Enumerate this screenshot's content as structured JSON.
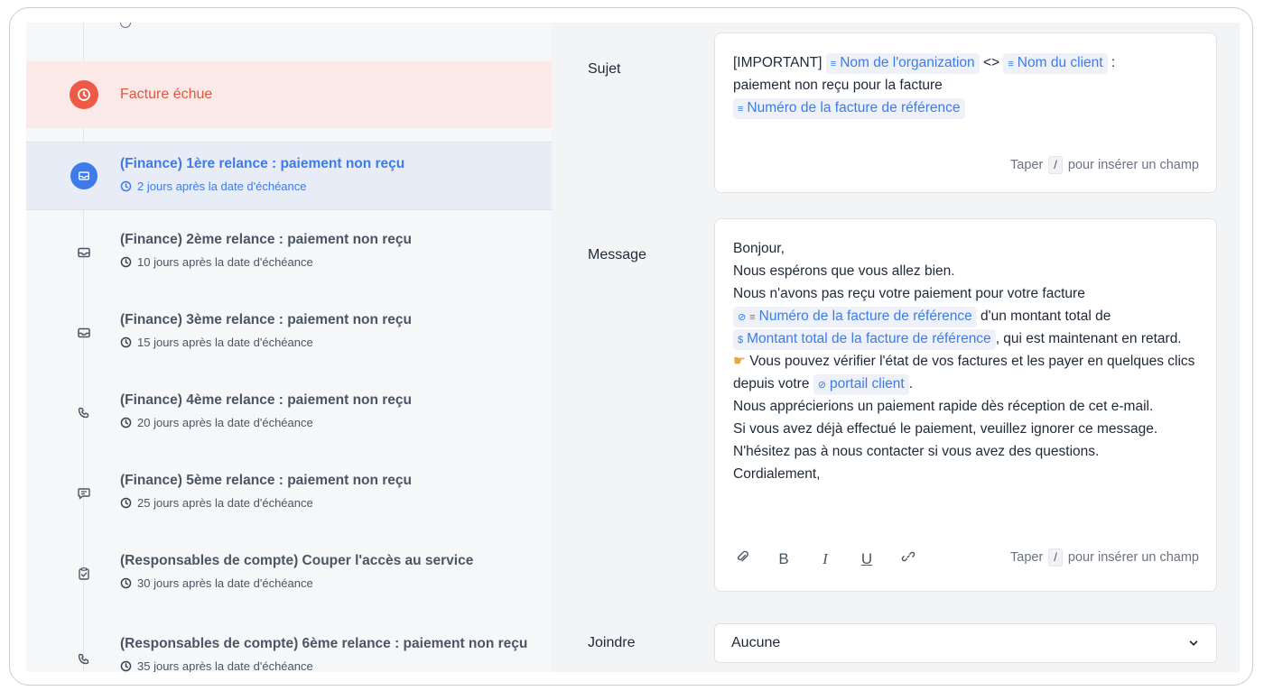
{
  "stub": {
    "text": "·"
  },
  "overdue": {
    "title": "Facture échue",
    "icon": "clock-icon"
  },
  "steps": [
    {
      "title": "(Finance) 1ère relance : paiement non reçu",
      "sub": "2 jours après la date d'échéance",
      "icon": "mail-icon"
    },
    {
      "title": "(Finance) 2ème relance : paiement non reçu",
      "sub": "10 jours après la date d'échéance",
      "icon": "mail-icon"
    },
    {
      "title": "(Finance) 3ème relance : paiement non reçu",
      "sub": "15 jours après la date d'échéance",
      "icon": "mail-icon"
    },
    {
      "title": "(Finance) 4ème relance : paiement non reçu",
      "sub": "20 jours après la date d'échéance",
      "icon": "phone-icon"
    },
    {
      "title": "(Finance) 5ème relance : paiement non reçu",
      "sub": "25 jours après la date d'échéance",
      "icon": "chat-icon"
    },
    {
      "title": "(Responsables de compte) Couper l'accès au service",
      "sub": "30 jours après la date d'échéance",
      "icon": "clipboard-check-icon"
    },
    {
      "title": "(Responsables de compte) 6ème relance : paiement non reçu",
      "sub": "35 jours après la date d'échéance",
      "icon": "phone-icon"
    }
  ],
  "form": {
    "subject_label": "Sujet",
    "message_label": "Message",
    "attach_label": "Joindre",
    "attach_value": "Aucune",
    "hint_prefix": "Taper",
    "hint_key": "/",
    "hint_suffix": "pour insérer un champ"
  },
  "subject": {
    "p1": "[IMPORTANT]",
    "chip1": "Nom de l'organization",
    "p2": "<>",
    "chip2": "Nom du client",
    "p3": ":",
    "p4": "paiement non reçu pour la facture",
    "chip3": "Numéro de la facture de référence"
  },
  "message": {
    "l1": "Bonjour,",
    "l2": "Nous espérons que vous allez bien.",
    "l3": "Nous n'avons pas reçu votre paiement pour votre facture",
    "chip_invoice": "Numéro de la facture de référence",
    "l4": "d'un montant total de",
    "chip_amount": "Montant total de la facture de référence",
    "l5": ", qui est maintenant en retard.",
    "l6a": "Vous pouvez vérifier l'état de vos factures et les payer en quelques clics depuis votre",
    "chip_portal": "portail client",
    "l6b": ".",
    "l7": "Nous apprécierions un paiement rapide dès réception de cet e-mail.",
    "l8": "Si vous avez déjà effectué le paiement, veuillez ignorer ce message.",
    "l9": "N'hésitez pas à nous contacter si vous avez des questions.",
    "l10": "Cordialement,"
  },
  "toolbar": {
    "bold": "B",
    "italic": "I",
    "underline": "U"
  }
}
